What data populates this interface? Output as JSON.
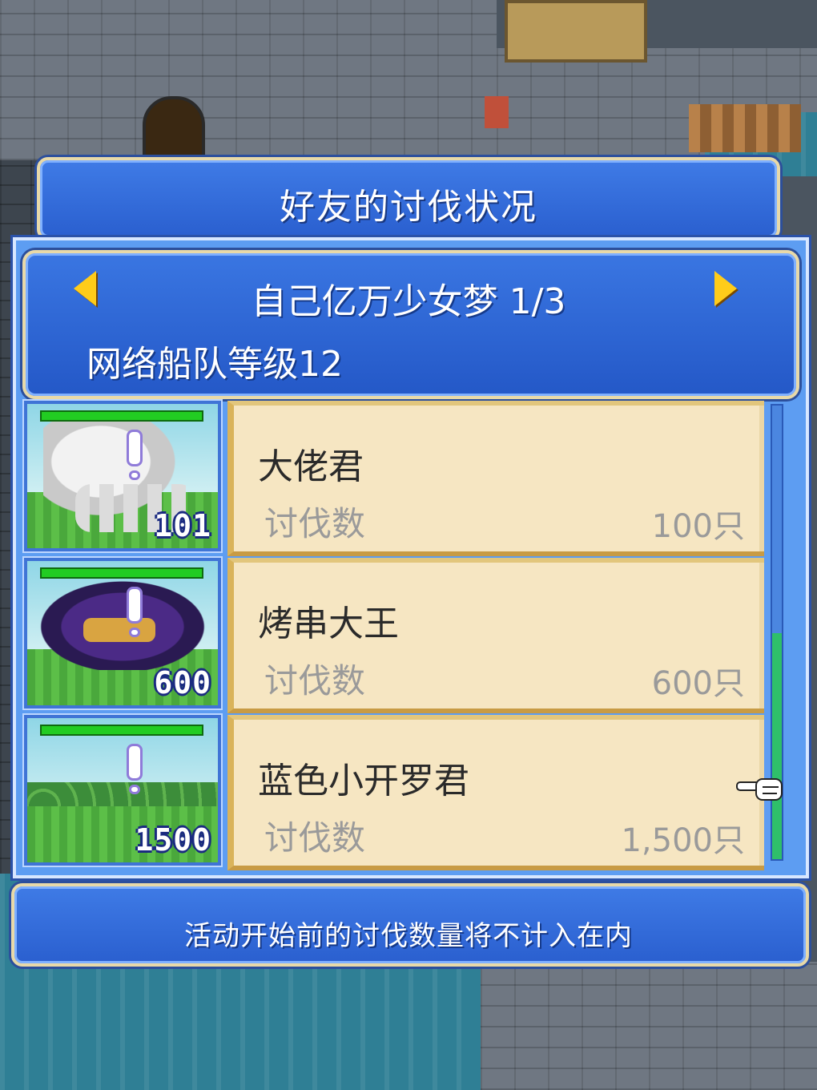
{
  "dialog": {
    "title": "好友的讨伐状况"
  },
  "friend": {
    "name_page": "自己亿万少女梦 1/3",
    "fleet_level": "网络船队等级12"
  },
  "rows": [
    {
      "name": "大佬君",
      "kill_label": "讨伐数",
      "kill_value": "100只",
      "monster_count": "101",
      "monster_icon": "squid-monster"
    },
    {
      "name": "烤串大王",
      "kill_label": "讨伐数",
      "kill_value": "600只",
      "monster_count": "600",
      "monster_icon": "bat-monster"
    },
    {
      "name": "蓝色小开罗君",
      "kill_label": "讨伐数",
      "kill_value": "1,500只",
      "monster_count": "1500",
      "monster_icon": "field-scene"
    }
  ],
  "notice": "活动开始前的讨伐数量将不计入在内",
  "colors": {
    "panel_blue": "#2a5fcf",
    "card_bg": "#f6e6c2",
    "arrow_gold": "#ffcc1a",
    "hp_green": "#22cc22"
  }
}
